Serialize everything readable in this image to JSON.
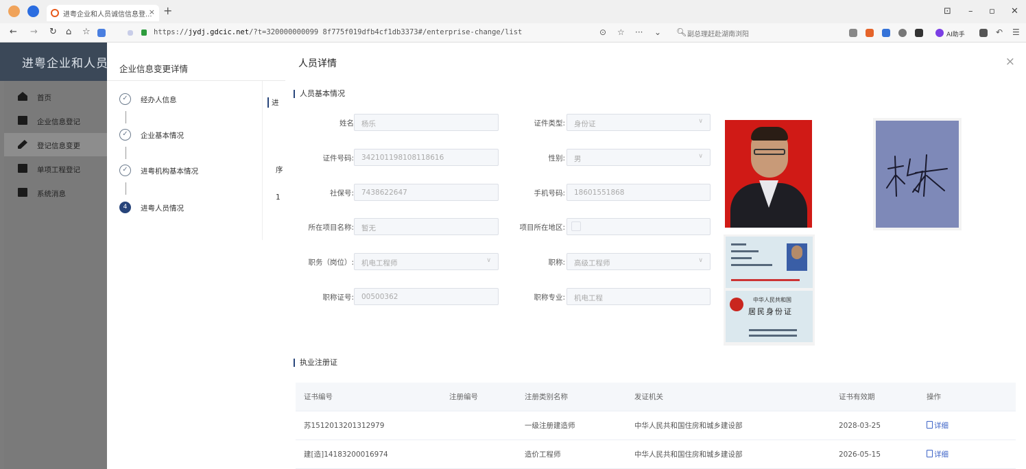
{
  "browser": {
    "tab_title": "进粤企业和人员诚信信息登...",
    "tab_close": "×",
    "new_tab": "+",
    "url_prefix": "https://",
    "url_host": "jydj.gdcic.net",
    "url_rest": "/?t=320000000099 8f775f019dfb4cf1db3373#/enterprise-change/list",
    "search_placeholder": "副总理赶赴湖南浏阳",
    "ai_label": "AI助手"
  },
  "app": {
    "title": "进粤企业和人员诚",
    "menu": [
      {
        "label": "首页"
      },
      {
        "label": "企业信息登记"
      },
      {
        "label": "登记信息变更"
      },
      {
        "label": "单项工程登记"
      },
      {
        "label": "系统消息"
      }
    ]
  },
  "change_dialog": {
    "title": "企业信息变更详情",
    "steps": [
      {
        "label": "经办人信息",
        "mark": "✓"
      },
      {
        "label": "企业基本情况",
        "mark": "✓"
      },
      {
        "label": "进粤机构基本情况",
        "mark": "✓"
      },
      {
        "label": "进粤人员情况",
        "mark": "4"
      }
    ],
    "frag_top": "进",
    "frag_mid": "序",
    "frag_num": "1"
  },
  "drawer": {
    "title": "人员详情",
    "close": "×",
    "section_basic": "人员基本情况",
    "section_cert": "执业注册证",
    "fields": {
      "name_label": "姓名",
      "name_value": "杨乐",
      "id_type_label": "证件类型:",
      "id_type_value": "身份证",
      "id_no_label": "证件号码:",
      "id_no_value": "342101198108118616",
      "gender_label": "性别:",
      "gender_value": "男",
      "social_label": "社保号:",
      "social_value": "7438622647",
      "phone_label": "手机号码:",
      "phone_value": "18601551868",
      "project_label": "所在项目名称:",
      "project_value": "暂无",
      "region_label": "项目所在地区:",
      "position_label": "职务（岗位）:",
      "position_value": "机电工程师",
      "title_label": "职称:",
      "title_value": "高级工程师",
      "cert_no_label": "职称证号:",
      "cert_no_value": "00500362",
      "major_label": "职称专业:",
      "major_value": "机电工程"
    },
    "id_card": {
      "line1": "中华人民共和国",
      "line2": "居民身份证"
    },
    "table": {
      "headers": [
        "证书编号",
        "注册编号",
        "注册类别名称",
        "发证机关",
        "证书有效期",
        "操作"
      ],
      "rows": [
        [
          "苏1512013201312979",
          "",
          "一级注册建造师",
          "中华人民共和国住房和城乡建设部",
          "2028-03-25",
          "详细"
        ],
        [
          "建[造]14183200016974",
          "",
          "造价工程师",
          "中华人民共和国住房和城乡建设部",
          "2026-05-15",
          "详细"
        ]
      ]
    }
  }
}
